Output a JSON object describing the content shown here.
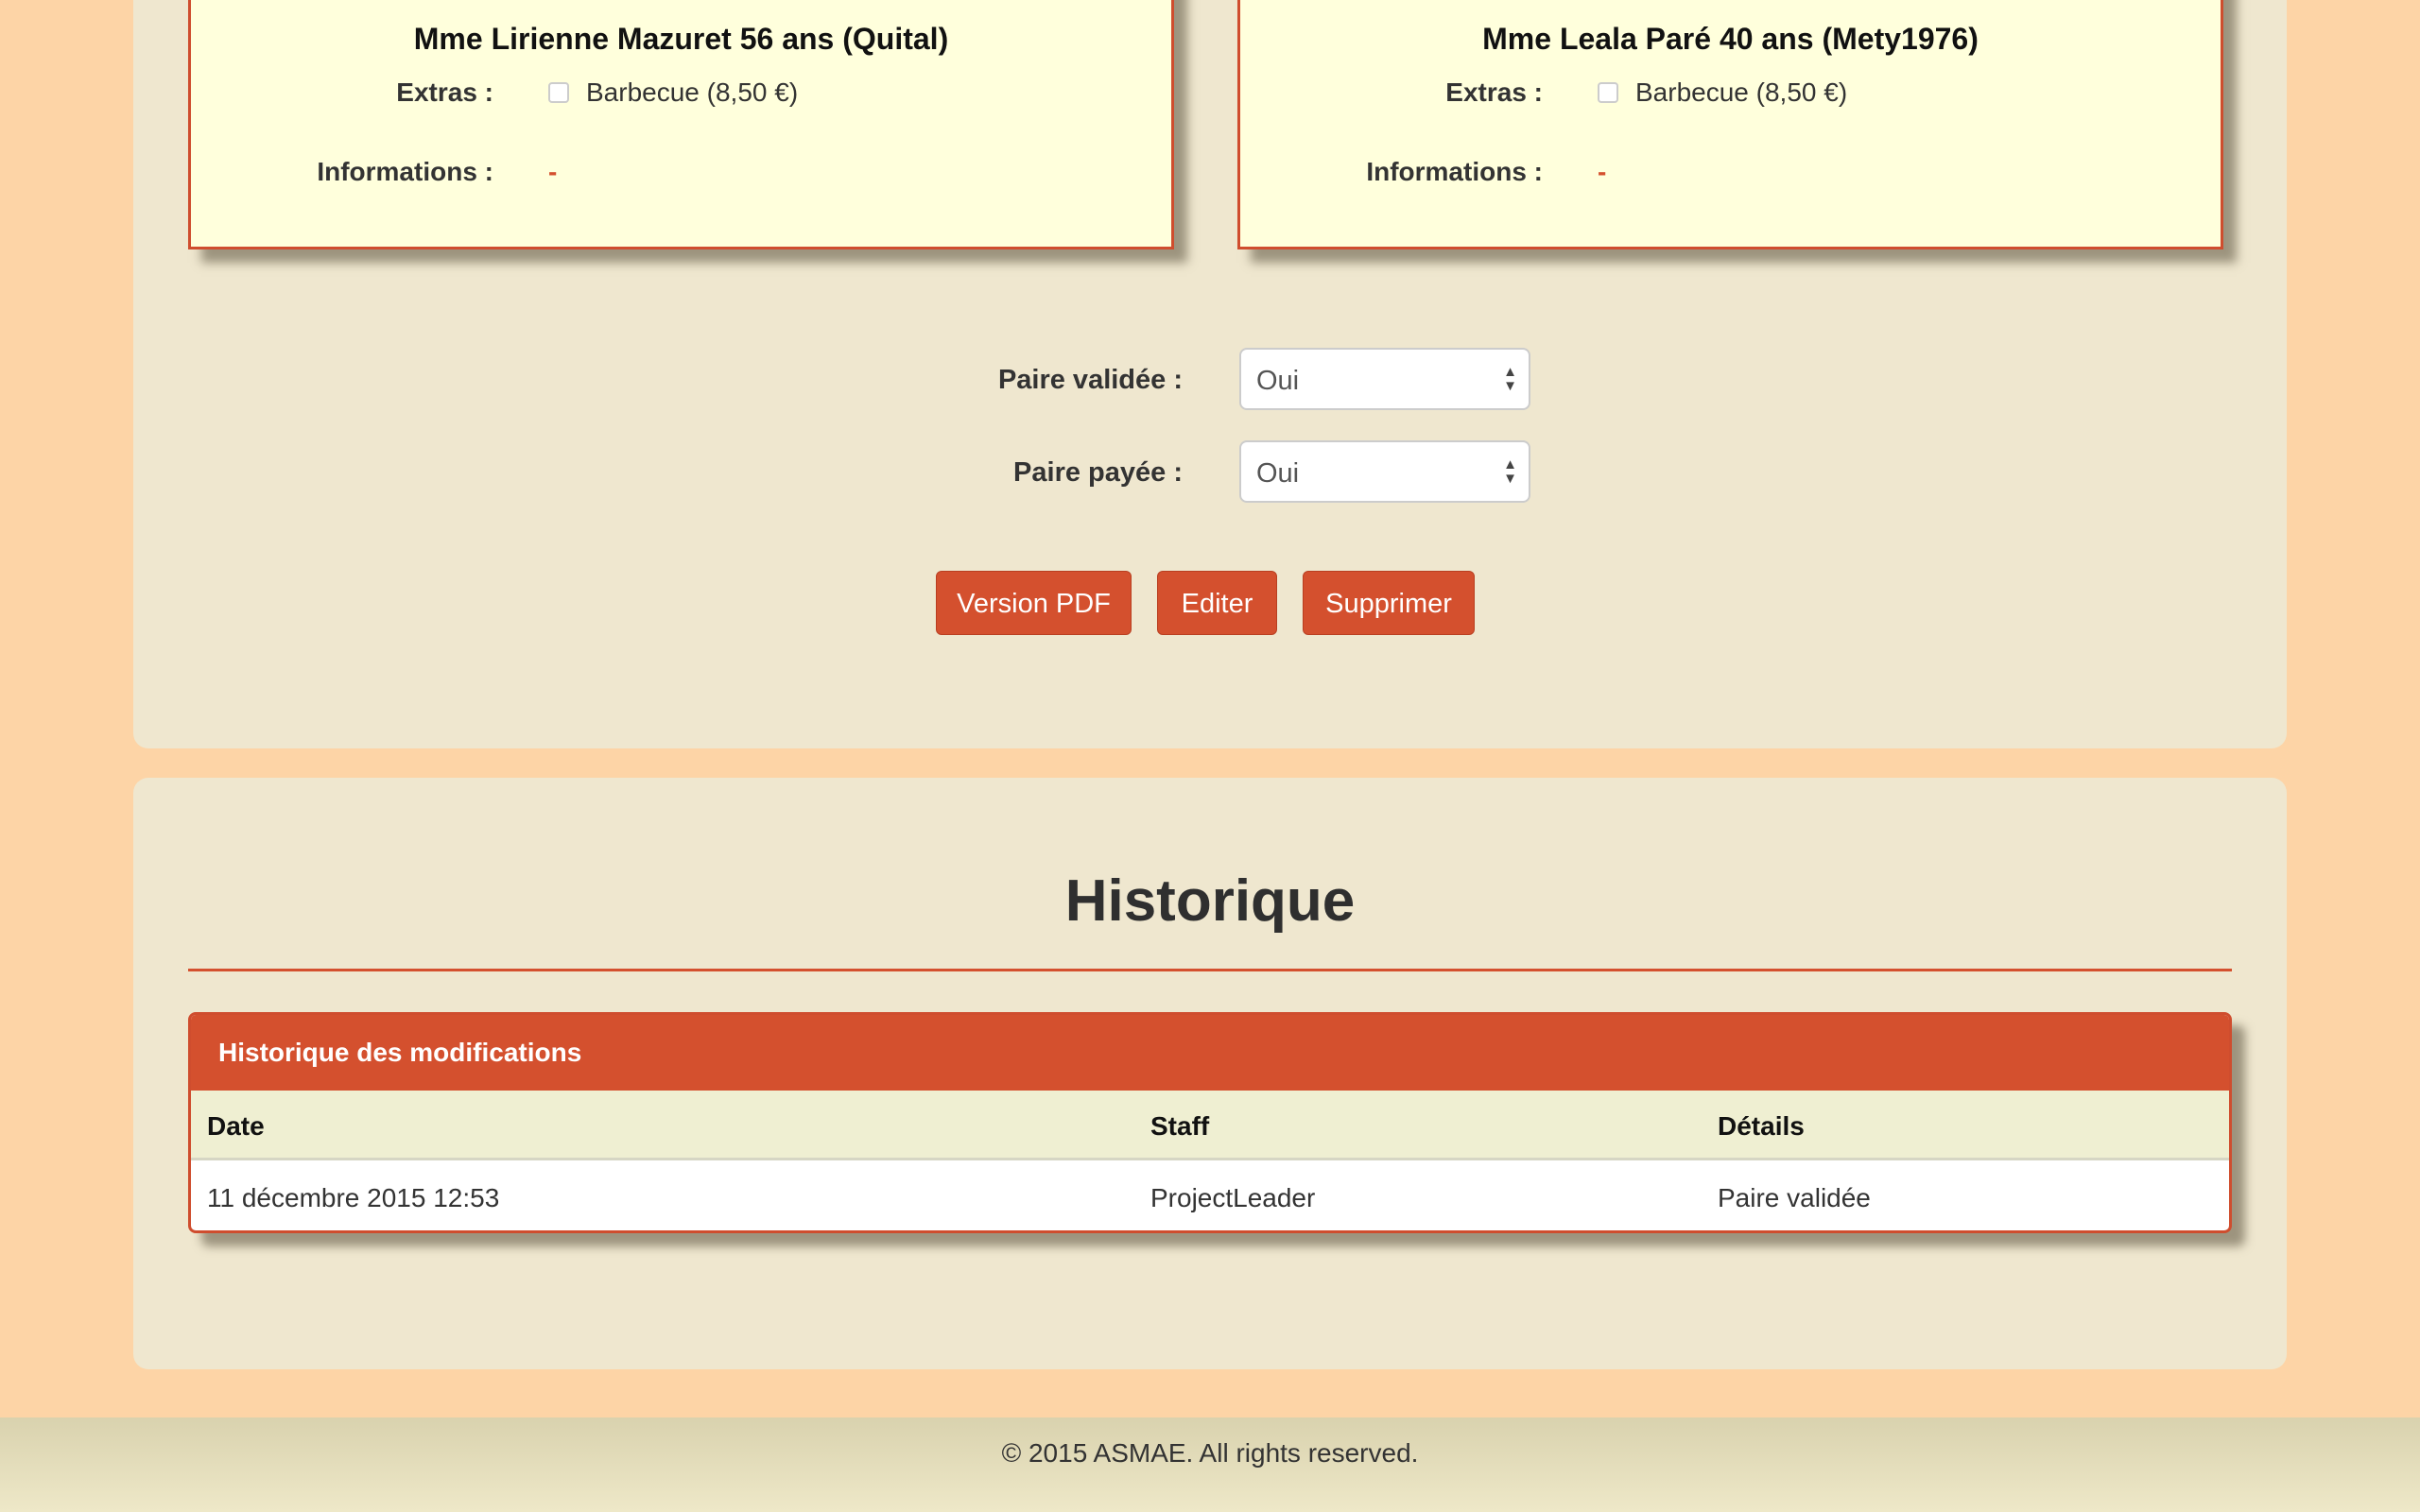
{
  "pair": {
    "left": {
      "title": "Mme Lirienne Mazuret 56 ans (Quital)",
      "extras_label": "Extras :",
      "extras_option": "Barbecue (8,50 €)",
      "extras_checked": false,
      "info_label": "Informations :",
      "info_value": "-"
    },
    "right": {
      "title": "Mme Leala Paré 40 ans (Mety1976)",
      "extras_label": "Extras :",
      "extras_option": "Barbecue (8,50 €)",
      "extras_checked": false,
      "info_label": "Informations :",
      "info_value": "-"
    }
  },
  "form": {
    "validee_label": "Paire validée :",
    "validee_value": "Oui",
    "payee_label": "Paire payée :",
    "payee_value": "Oui"
  },
  "actions": {
    "pdf": "Version PDF",
    "edit": "Editer",
    "delete": "Supprimer"
  },
  "history": {
    "section_title": "Historique",
    "box_title": "Historique des modifications",
    "columns": [
      "Date",
      "Staff",
      "Détails"
    ],
    "rows": [
      [
        "11 décembre 2015 12:53",
        "ProjectLeader",
        "Paire validée"
      ]
    ]
  },
  "footer": {
    "text": "© 2015 ASMAE. All rights reserved."
  },
  "colors": {
    "accent": "#d4502e",
    "background": "#fdd4a6",
    "panel": "#efe7cf",
    "card": "#ffffdc"
  }
}
